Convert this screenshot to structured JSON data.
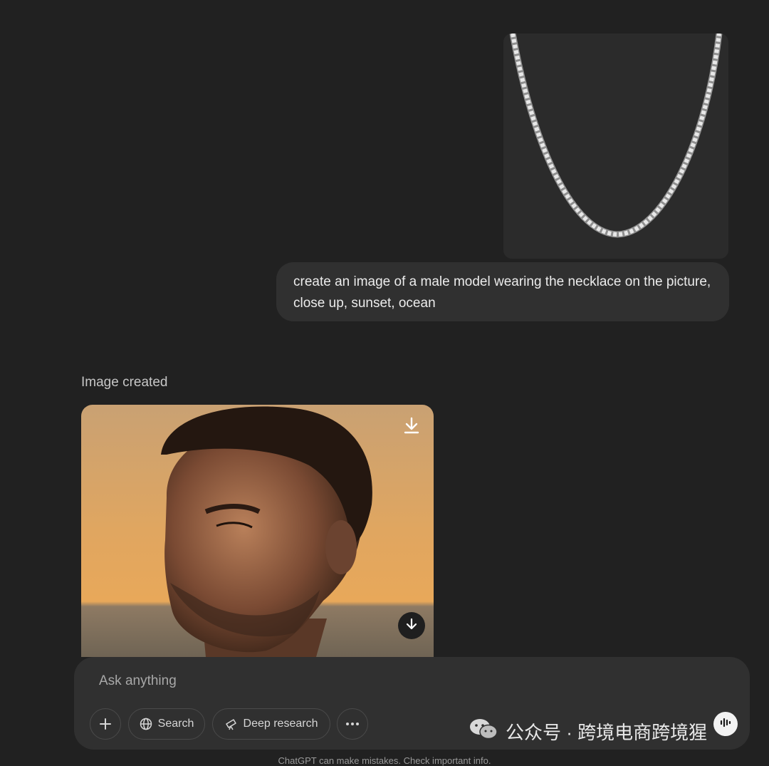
{
  "conversation": {
    "user_message": "create an image of a male model wearing the necklace on the picture, close up, sunset, ocean",
    "assistant_status": "Image created"
  },
  "icons": {
    "download_top": "download-icon",
    "download_round": "arrow-down-icon",
    "plus": "plus-icon",
    "search": "globe-icon",
    "deep_research": "telescope-icon",
    "more": "ellipsis-icon",
    "voice": "voice-mode-icon",
    "watermark": "wechat-icon"
  },
  "composer": {
    "placeholder": "Ask anything",
    "search_label": "Search",
    "deep_research_label": "Deep research"
  },
  "watermark": {
    "text": "公众号 · 跨境电商跨境猩"
  },
  "footer": {
    "text": "ChatGPT can make mistakes. Check important info."
  },
  "colors": {
    "background": "#212121",
    "bubble": "#303030",
    "composer": "#303030"
  }
}
